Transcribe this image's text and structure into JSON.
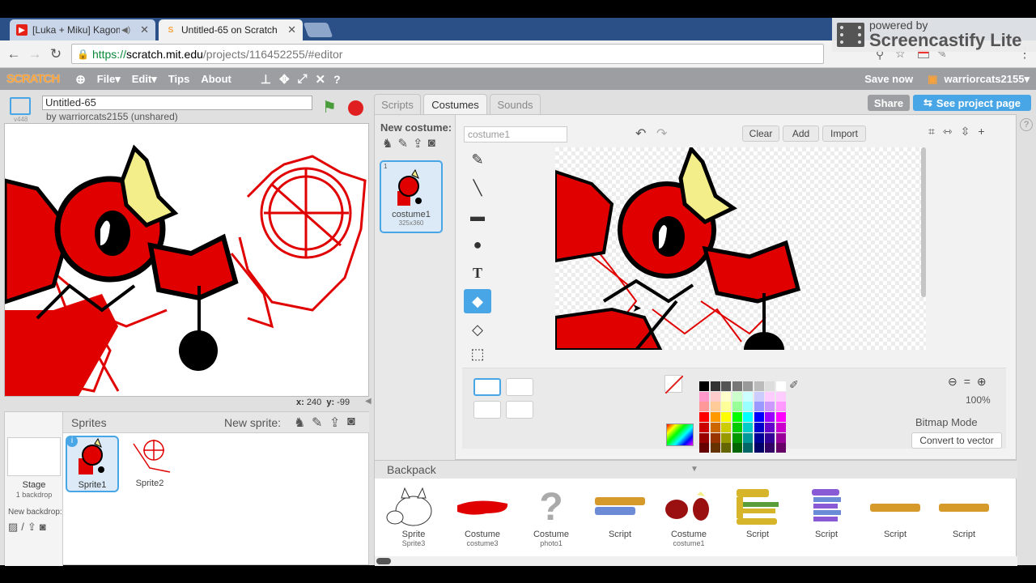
{
  "browser": {
    "tabs": [
      {
        "title": "[Luka + Miku] Kagom",
        "active": false
      },
      {
        "title": "Untitled-65 on Scratch",
        "active": true
      }
    ],
    "url_prefix": "https://",
    "url_host": "scratch.mit.edu",
    "url_path": "/projects/116452255/#editor"
  },
  "watermark": {
    "line1": "powered by",
    "line2": "Screencastify Lite"
  },
  "menu": {
    "logo": "SCRATCH",
    "items": [
      "File",
      "Edit",
      "Tips",
      "About"
    ],
    "save_now": "Save now",
    "username": "warriorcats2155"
  },
  "project": {
    "title": "Untitled-65",
    "byline": "by warriorcats2155 (unshared)",
    "version": "v448"
  },
  "stage": {
    "coords_x_label": "x:",
    "coords_x": "240",
    "coords_y_label": "y:",
    "coords_y": "-99"
  },
  "sprites_panel": {
    "title": "Sprites",
    "new_sprite": "New sprite:",
    "stage_label": "Stage",
    "stage_sub": "1 backdrop",
    "new_backdrop": "New backdrop:",
    "sprites": [
      {
        "name": "Sprite1",
        "selected": true
      },
      {
        "name": "Sprite2",
        "selected": false
      }
    ]
  },
  "editor": {
    "tabs": [
      "Scripts",
      "Costumes",
      "Sounds"
    ],
    "active_tab": "Costumes",
    "share": "Share",
    "see_project": "See project page",
    "new_costume": "New costume:",
    "costume": {
      "index": "1",
      "name": "costume1",
      "size": "325x360"
    },
    "costume_name_field": "costume1",
    "buttons": {
      "clear": "Clear",
      "add": "Add",
      "import": "Import"
    },
    "zoom": "100%",
    "mode": "Bitmap Mode",
    "convert": "Convert to vector"
  },
  "backpack": {
    "title": "Backpack",
    "items": [
      {
        "type": "Sprite",
        "name": "Sprite3"
      },
      {
        "type": "Costume",
        "name": "costume3"
      },
      {
        "type": "Costume",
        "name": "photo1"
      },
      {
        "type": "Script",
        "name": ""
      },
      {
        "type": "Costume",
        "name": "costume1"
      },
      {
        "type": "Script",
        "name": ""
      },
      {
        "type": "Script",
        "name": ""
      },
      {
        "type": "Script",
        "name": ""
      },
      {
        "type": "Script",
        "name": ""
      }
    ]
  },
  "colors": {
    "scratch_blue": "#49a6e6",
    "menu_gray": "#9c9ea2",
    "flag_green": "#4a9d3b",
    "stop_red": "#e02020",
    "drawing_red": "#e00000"
  }
}
